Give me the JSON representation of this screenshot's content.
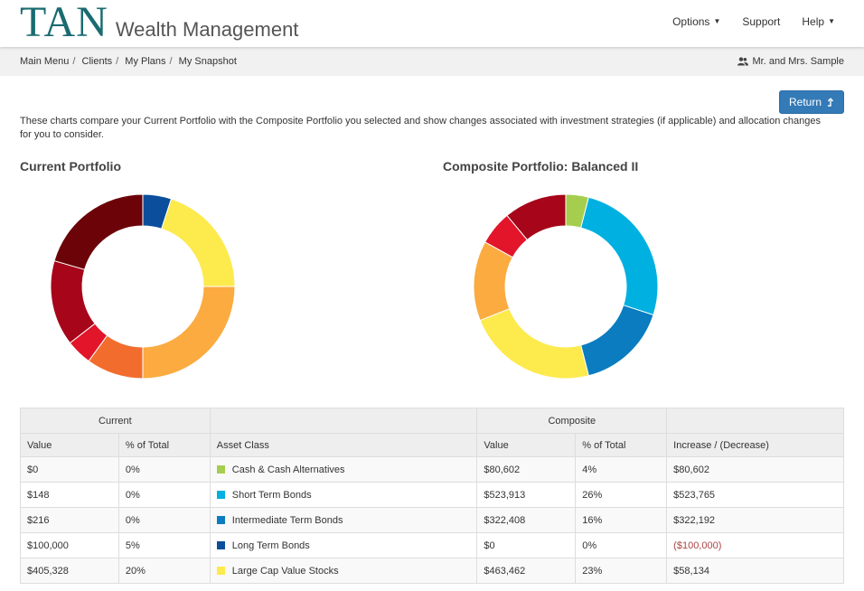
{
  "header": {
    "logo_main": "TAN",
    "logo_sub": "Wealth Management",
    "nav": [
      {
        "label": "Options",
        "caret": true
      },
      {
        "label": "Support",
        "caret": false
      },
      {
        "label": "Help",
        "caret": true
      }
    ]
  },
  "breadcrumb": [
    "Main Menu",
    "Clients",
    "My Plans",
    "My Snapshot"
  ],
  "client_name": "Mr. and Mrs. Sample",
  "return_label": "Return",
  "intro_text": "These charts compare your Current Portfolio with the Composite Portfolio you selected and show changes associated with investment strategies (if applicable) and allocation changes for you to consider.",
  "charts": {
    "current_title": "Current Portfolio",
    "composite_title": "Composite Portfolio: Balanced II"
  },
  "colors": {
    "cash": "#a6ce4e",
    "short_bonds": "#00b0e0",
    "intermediate_bonds": "#0a7cbf",
    "long_bonds": "#0b4f9c",
    "large_cap_value": "#fdea4d",
    "orange_light": "#fbab40",
    "orange_dark": "#f26d2d",
    "red": "#e2152b",
    "dark_red": "#a6051a",
    "maroon": "#6b0308",
    "accent_blue": "#337ab7",
    "negative": "#a94442"
  },
  "chart_data": [
    {
      "type": "pie",
      "title": "Current Portfolio",
      "slices": [
        {
          "value": 5,
          "color": "#0b4f9c"
        },
        {
          "value": 20,
          "color": "#fdea4d"
        },
        {
          "value": 25,
          "color": "#fbab40"
        },
        {
          "value": 10,
          "color": "#f26d2d"
        },
        {
          "value": 4.5,
          "color": "#e2152b"
        },
        {
          "value": 15,
          "color": "#a6051a"
        },
        {
          "value": 20.5,
          "color": "#6b0308"
        }
      ]
    },
    {
      "type": "pie",
      "title": "Composite Portfolio: Balanced II",
      "slices": [
        {
          "value": 4,
          "color": "#a6ce4e"
        },
        {
          "value": 26,
          "color": "#00b0e0"
        },
        {
          "value": 16,
          "color": "#0a7cbf"
        },
        {
          "value": 23,
          "color": "#fdea4d"
        },
        {
          "value": 14,
          "color": "#fbab40"
        },
        {
          "value": 6,
          "color": "#e2152b"
        },
        {
          "value": 11,
          "color": "#a6051a"
        }
      ]
    }
  ],
  "table": {
    "group_headers": {
      "current": "Current",
      "composite": "Composite"
    },
    "columns": [
      "Value",
      "% of Total",
      "Asset Class",
      "Value",
      "% of Total",
      "Increase / (Decrease)"
    ],
    "rows": [
      {
        "cur_value": "$0",
        "cur_pct": "0%",
        "asset": "Cash & Cash Alternatives",
        "color": "#a6ce4e",
        "comp_value": "$80,602",
        "comp_pct": "4%",
        "change": "$80,602",
        "negative": false
      },
      {
        "cur_value": "$148",
        "cur_pct": "0%",
        "asset": "Short Term Bonds",
        "color": "#00b0e0",
        "comp_value": "$523,913",
        "comp_pct": "26%",
        "change": "$523,765",
        "negative": false
      },
      {
        "cur_value": "$216",
        "cur_pct": "0%",
        "asset": "Intermediate Term Bonds",
        "color": "#0a7cbf",
        "comp_value": "$322,408",
        "comp_pct": "16%",
        "change": "$322,192",
        "negative": false
      },
      {
        "cur_value": "$100,000",
        "cur_pct": "5%",
        "asset": "Long Term Bonds",
        "color": "#0b4f9c",
        "comp_value": "$0",
        "comp_pct": "0%",
        "change": "($100,000)",
        "negative": true
      },
      {
        "cur_value": "$405,328",
        "cur_pct": "20%",
        "asset": "Large Cap Value Stocks",
        "color": "#fdea4d",
        "comp_value": "$463,462",
        "comp_pct": "23%",
        "change": "$58,134",
        "negative": false
      }
    ]
  }
}
